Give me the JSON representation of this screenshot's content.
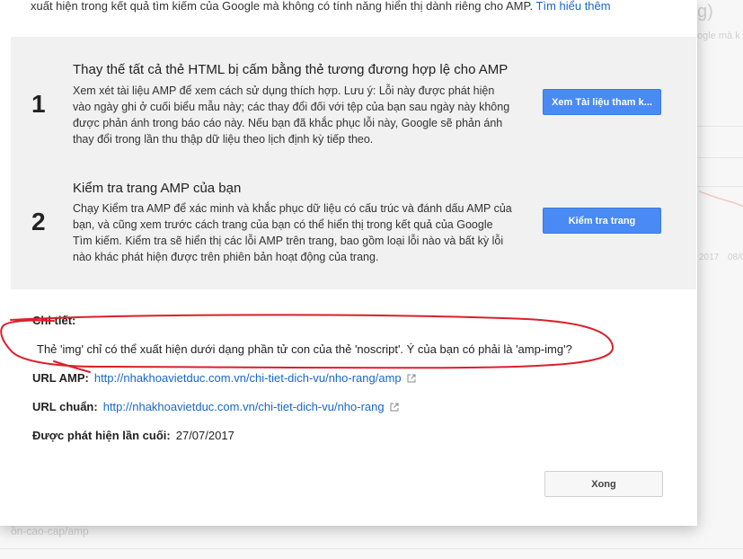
{
  "background": {
    "frag_g": "g)",
    "frag_google": "ogle mà k",
    "frag_date1": "2017",
    "frag_date2": "08/0",
    "frag_bottom": "ồn-cao-cap/amp"
  },
  "dialog": {
    "top_text": "xuất hiện trong kết quả tìm kiếm của Google mà không có tính năng hiển thị dành riêng cho AMP.",
    "top_link": "Tìm hiểu thêm",
    "steps": [
      {
        "number": "1",
        "title": "Thay thế tất cả thẻ HTML bị cấm bằng thẻ tương đương hợp lệ cho AMP",
        "description": "Xem xét tài liệu AMP để xem cách sử dụng thích hợp. Lưu ý: Lỗi này được phát hiện vào ngày ghi ở cuối biểu mẫu này; các thay đổi đối với tệp của bạn sau ngày này không được phản ánh trong báo cáo này. Nếu bạn đã khắc phục lỗi này, Google sẽ phản ánh thay đổi trong lần thu thập dữ liệu theo lịch định kỳ tiếp theo.",
        "button": "Xem Tài liệu tham k..."
      },
      {
        "number": "2",
        "title": "Kiểm tra trang AMP của bạn",
        "description": "Chạy Kiểm tra AMP để xác minh và khắc phục dữ liệu có cấu trúc và đánh dấu AMP của bạn, và cũng xem trước cách trang của bạn có thể hiển thị trong kết quả của Google Tìm kiếm. Kiểm tra sẽ hiển thị các lỗi AMP trên trang, bao gồm loại lỗi nào và bất kỳ lỗi nào khác phát hiện được trên phiên bản hoạt động của trang.",
        "button": "Kiểm tra trang"
      }
    ],
    "details_label": "Chi tiết:",
    "details_message": "Thẻ 'img' chỉ có thể xuất hiện dưới dạng phần tử con của thẻ 'noscript'. Ý của bạn có phải là 'amp-img'?",
    "amp_url_label": "URL AMP:",
    "amp_url": "http://nhakhoavietduc.com.vn/chi-tiet-dich-vu/nho-rang/amp",
    "canonical_label": "URL chuẩn:",
    "canonical_url": "http://nhakhoavietduc.com.vn/chi-tiet-dich-vu/nho-rang",
    "last_detected_label": "Được phát hiện lần cuối:",
    "last_detected_value": "27/07/2017",
    "done_button": "Xong"
  },
  "colors": {
    "link": "#1a66c9",
    "primary_button": "#4a8af4",
    "annotation": "#d9212b",
    "panel": "#f1f1f1"
  },
  "icons": {
    "external_link": "external-link-icon"
  }
}
